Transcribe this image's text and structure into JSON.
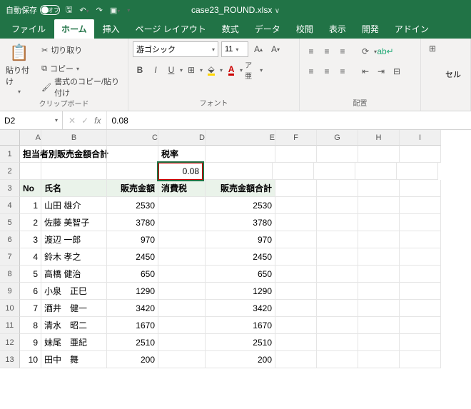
{
  "titlebar": {
    "autosave_label": "自動保存",
    "autosave_state": "オフ",
    "filename": "case23_ROUND.xlsx"
  },
  "tabs": [
    "ファイル",
    "ホーム",
    "挿入",
    "ページ レイアウト",
    "数式",
    "データ",
    "校閲",
    "表示",
    "開発",
    "アドイン"
  ],
  "active_tab": 1,
  "ribbon": {
    "clipboard": {
      "paste": "貼り付け",
      "cut": "切り取り",
      "copy": "コピー",
      "format_painter": "書式のコピー/貼り付け",
      "label": "クリップボード"
    },
    "font": {
      "name": "游ゴシック",
      "size": "11",
      "bold": "B",
      "italic": "I",
      "underline": "U",
      "label": "フォント"
    },
    "alignment": {
      "label": "配置"
    },
    "cells": {
      "label": "セル"
    }
  },
  "namebox": "D2",
  "formula": "0.08",
  "columns": [
    "A",
    "B",
    "C",
    "D",
    "E",
    "F",
    "G",
    "H",
    "I"
  ],
  "a1": "担当者別販売金額合計",
  "d1": "税率",
  "d2": "0.08",
  "headers": {
    "A": "No",
    "B": "氏名",
    "C": "販売金額",
    "D": "消費税",
    "E": "販売金額合計"
  },
  "rows": [
    {
      "no": 1,
      "name": "山田 雄介",
      "sales": 2530,
      "total": 2530
    },
    {
      "no": 2,
      "name": "佐藤 美智子",
      "sales": 3780,
      "total": 3780
    },
    {
      "no": 3,
      "name": "渡辺 一郎",
      "sales": 970,
      "total": 970
    },
    {
      "no": 4,
      "name": "鈴木 孝之",
      "sales": 2450,
      "total": 2450
    },
    {
      "no": 5,
      "name": "高橋 健治",
      "sales": 650,
      "total": 650
    },
    {
      "no": 6,
      "name": "小泉　正巳",
      "sales": 1290,
      "total": 1290
    },
    {
      "no": 7,
      "name": "酒井　健一",
      "sales": 3420,
      "total": 3420
    },
    {
      "no": 8,
      "name": "清水　昭二",
      "sales": 1670,
      "total": 1670
    },
    {
      "no": 9,
      "name": "妹尾　亜紀",
      "sales": 2510,
      "total": 2510
    },
    {
      "no": 10,
      "name": "田中　舞",
      "sales": 200,
      "total": 200
    }
  ]
}
